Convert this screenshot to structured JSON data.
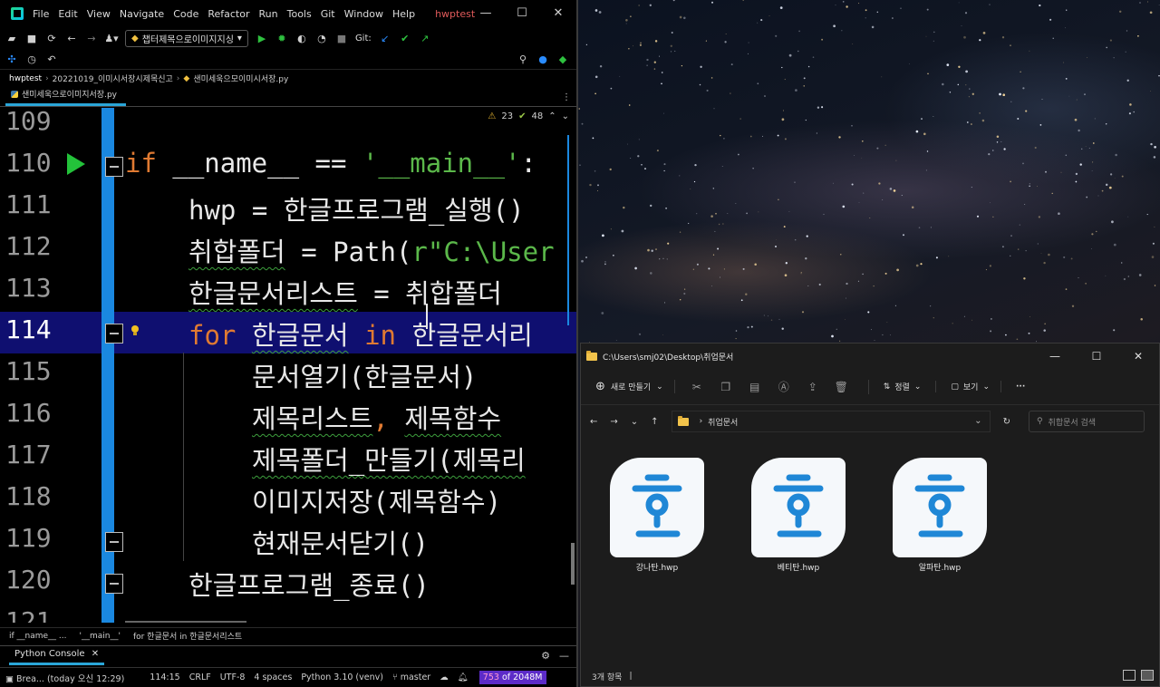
{
  "ide": {
    "menu": [
      "File",
      "Edit",
      "View",
      "Navigate",
      "Code",
      "Refactor",
      "Run",
      "Tools",
      "Git",
      "Window",
      "Help"
    ],
    "project_title": "hwptest",
    "window_controls": {
      "minimize": "—",
      "maximize": "☐",
      "close": "✕"
    },
    "run_config": "챕터제목으로이미지지싱",
    "git_label": "Git:",
    "breadcrumbs": [
      "hwptest",
      "20221019_이미시서장시제목신고",
      "샌미세욱으모이미시서장.py"
    ],
    "active_tab": "샌미세욱으로이미지서장.py",
    "inspection": {
      "warnings": "23",
      "weak_warnings": "48"
    },
    "line_numbers": [
      "109",
      "110",
      "111",
      "112",
      "113",
      "114",
      "115",
      "116",
      "117",
      "118",
      "119",
      "120",
      "121"
    ],
    "code": {
      "l110_kw": "if",
      "l110_rest": " __name__ == ",
      "l110_str": "'__main__'",
      "l110_end": ":",
      "l111": "hwp = 한글프로그램_실행()",
      "l112_var": "취합폴더",
      "l112_mid": " = Path(",
      "l112_str": "r\"C:\\User",
      "l113_var": "한글문서리스트",
      "l113_rest": " = 취합폴더",
      "l114_kw": "for",
      "l114_var": "한글문서",
      "l114_in": "in",
      "l114_rest": " 한글문서리",
      "l115": "문서열기(한글문서)",
      "l116_a": "제목리스트",
      "l116_comma": ",",
      "l116_b": "제목함수",
      "l117": "제목폴더_만들기(제목리",
      "l118": "이미지저장(제목함수)",
      "l119": "현재문서닫기()",
      "l120": "한글프로그램_종료()"
    },
    "code_breadcrumb": [
      "if __name__ ...",
      "'__main__'",
      "for 한글문서 in 한글문서리스트"
    ],
    "console_tab": "Python Console",
    "status": {
      "breakpoint": "Brea... (today 오신 12:29)",
      "position": "114:15",
      "line_sep": "CRLF",
      "encoding": "UTF-8",
      "indent": "4 spaces",
      "interpreter": "Python 3.10 (venv)",
      "branch": "master",
      "mem_used": "753",
      "mem_of": "of 2048M"
    }
  },
  "explorer": {
    "title_path": "C:\\Users\\smj02\\Desktop\\취업문서",
    "new_label": "새로 만들기",
    "sort_label": "정렬",
    "view_label": "보기",
    "more_label": "···",
    "address": "취업문서",
    "search_placeholder": "취합문서 검색",
    "files": [
      {
        "name": "강나탄.hwp"
      },
      {
        "name": "베티탄.hwp"
      },
      {
        "name": "알파탄.hwp"
      }
    ],
    "item_count": "3개 항목",
    "icon_color": "#1f87d6"
  }
}
